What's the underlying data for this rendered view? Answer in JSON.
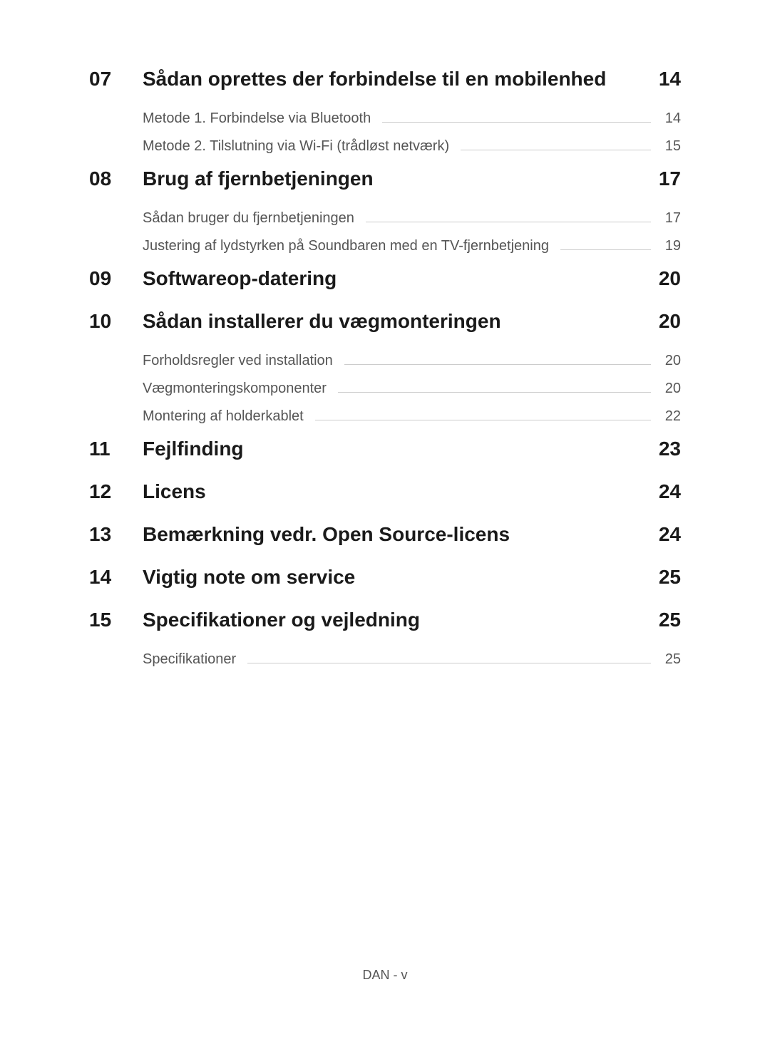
{
  "toc": [
    {
      "num": "07",
      "title": "Sådan oprettes der forbindelse til en mobilenhed",
      "page": "14",
      "subs": [
        {
          "title": "Metode 1. Forbindelse via Bluetooth",
          "page": "14"
        },
        {
          "title": "Metode 2. Tilslutning via Wi-Fi (trådløst netværk)",
          "page": "15"
        }
      ]
    },
    {
      "num": "08",
      "title": "Brug af fjernbetjeningen",
      "page": "17",
      "subs": [
        {
          "title": "Sådan bruger du fjernbetjeningen",
          "page": "17"
        },
        {
          "title": "Justering af lydstyrken på Soundbaren med en TV-fjernbetjening",
          "page": "19"
        }
      ]
    },
    {
      "num": "09",
      "title": "Softwareop-datering",
      "page": "20",
      "subs": []
    },
    {
      "num": "10",
      "title": "Sådan installerer du vægmonteringen",
      "page": "20",
      "subs": [
        {
          "title": "Forholdsregler ved installation",
          "page": "20"
        },
        {
          "title": "Vægmonteringskomponenter",
          "page": "20"
        },
        {
          "title": "Montering af holderkablet",
          "page": "22"
        }
      ]
    },
    {
      "num": "11",
      "title": "Fejlfinding",
      "page": "23",
      "subs": []
    },
    {
      "num": "12",
      "title": "Licens",
      "page": "24",
      "subs": []
    },
    {
      "num": "13",
      "title": "Bemærkning vedr. Open Source-licens",
      "page": "24",
      "subs": []
    },
    {
      "num": "14",
      "title": "Vigtig note om service",
      "page": "25",
      "subs": []
    },
    {
      "num": "15",
      "title": "Specifikationer og vejledning",
      "page": "25",
      "subs": [
        {
          "title": "Specifikationer",
          "page": "25"
        }
      ]
    }
  ],
  "footer": "DAN - v"
}
